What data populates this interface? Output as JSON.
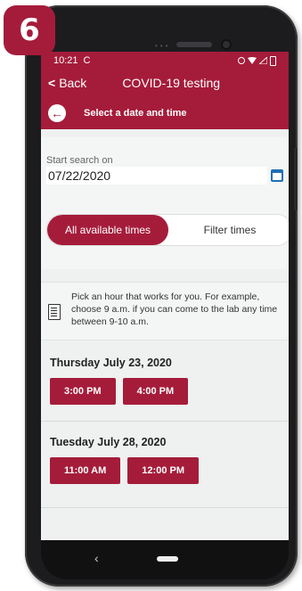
{
  "step_badge": "6",
  "status_bar": {
    "time": "10:21",
    "sync_icon": "C"
  },
  "header": {
    "back_label": "Back",
    "title": "COVID-19 testing",
    "subtitle": "Select a date and time"
  },
  "search": {
    "label": "Start search on",
    "date_value": "07/22/2020"
  },
  "toggle": {
    "active": "All available times",
    "inactive": "Filter times"
  },
  "info": {
    "text": "Pick an hour that works for you. For example, choose 9 a.m. if you can come to the lab any time between 9-10 a.m."
  },
  "days": [
    {
      "title": "Thursday July 23, 2020",
      "slots": [
        "3:00 PM",
        "4:00 PM"
      ]
    },
    {
      "title": "Tuesday July 28, 2020",
      "slots": [
        "11:00 AM",
        "12:00 PM"
      ]
    }
  ],
  "nav": {
    "back_glyph": "‹"
  },
  "colors": {
    "brand": "#a51c3a",
    "calendar_icon": "#1d6fb8"
  }
}
